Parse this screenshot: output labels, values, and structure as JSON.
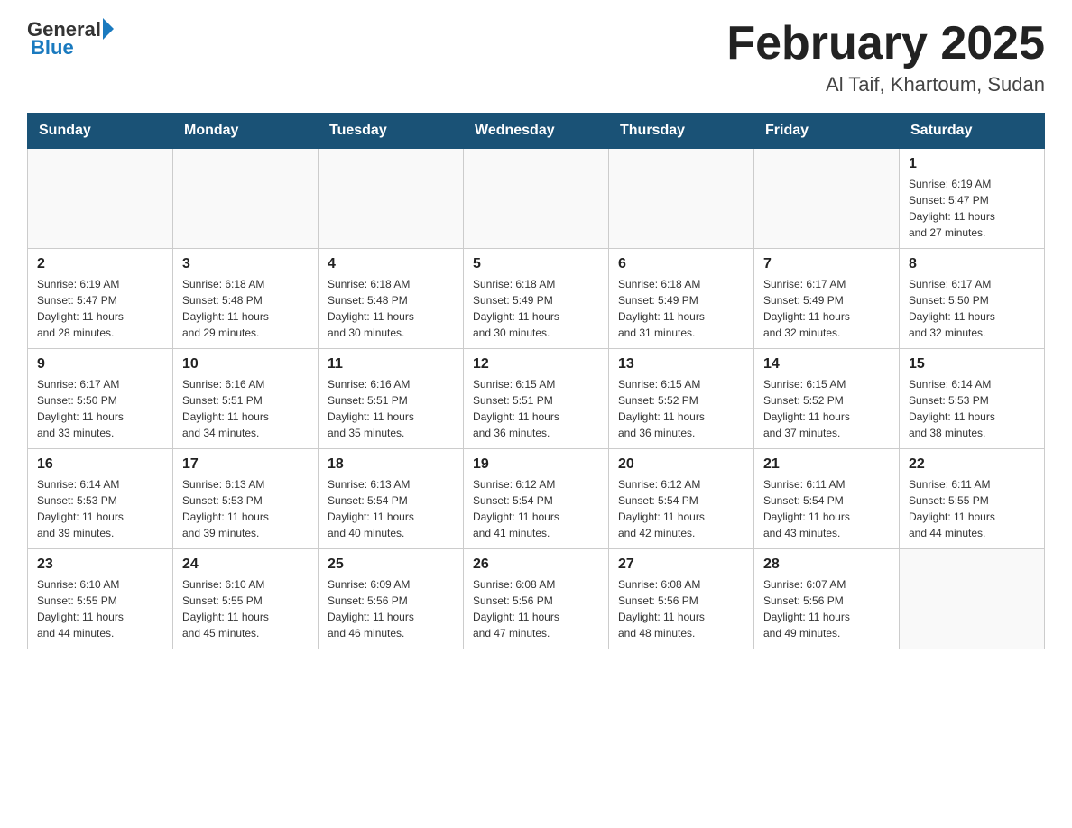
{
  "header": {
    "logo_general": "General",
    "logo_blue": "Blue",
    "title": "February 2025",
    "subtitle": "Al Taif, Khartoum, Sudan"
  },
  "days_of_week": [
    "Sunday",
    "Monday",
    "Tuesday",
    "Wednesday",
    "Thursday",
    "Friday",
    "Saturday"
  ],
  "weeks": [
    [
      {
        "day": "",
        "info": ""
      },
      {
        "day": "",
        "info": ""
      },
      {
        "day": "",
        "info": ""
      },
      {
        "day": "",
        "info": ""
      },
      {
        "day": "",
        "info": ""
      },
      {
        "day": "",
        "info": ""
      },
      {
        "day": "1",
        "info": "Sunrise: 6:19 AM\nSunset: 5:47 PM\nDaylight: 11 hours\nand 27 minutes."
      }
    ],
    [
      {
        "day": "2",
        "info": "Sunrise: 6:19 AM\nSunset: 5:47 PM\nDaylight: 11 hours\nand 28 minutes."
      },
      {
        "day": "3",
        "info": "Sunrise: 6:18 AM\nSunset: 5:48 PM\nDaylight: 11 hours\nand 29 minutes."
      },
      {
        "day": "4",
        "info": "Sunrise: 6:18 AM\nSunset: 5:48 PM\nDaylight: 11 hours\nand 30 minutes."
      },
      {
        "day": "5",
        "info": "Sunrise: 6:18 AM\nSunset: 5:49 PM\nDaylight: 11 hours\nand 30 minutes."
      },
      {
        "day": "6",
        "info": "Sunrise: 6:18 AM\nSunset: 5:49 PM\nDaylight: 11 hours\nand 31 minutes."
      },
      {
        "day": "7",
        "info": "Sunrise: 6:17 AM\nSunset: 5:49 PM\nDaylight: 11 hours\nand 32 minutes."
      },
      {
        "day": "8",
        "info": "Sunrise: 6:17 AM\nSunset: 5:50 PM\nDaylight: 11 hours\nand 32 minutes."
      }
    ],
    [
      {
        "day": "9",
        "info": "Sunrise: 6:17 AM\nSunset: 5:50 PM\nDaylight: 11 hours\nand 33 minutes."
      },
      {
        "day": "10",
        "info": "Sunrise: 6:16 AM\nSunset: 5:51 PM\nDaylight: 11 hours\nand 34 minutes."
      },
      {
        "day": "11",
        "info": "Sunrise: 6:16 AM\nSunset: 5:51 PM\nDaylight: 11 hours\nand 35 minutes."
      },
      {
        "day": "12",
        "info": "Sunrise: 6:15 AM\nSunset: 5:51 PM\nDaylight: 11 hours\nand 36 minutes."
      },
      {
        "day": "13",
        "info": "Sunrise: 6:15 AM\nSunset: 5:52 PM\nDaylight: 11 hours\nand 36 minutes."
      },
      {
        "day": "14",
        "info": "Sunrise: 6:15 AM\nSunset: 5:52 PM\nDaylight: 11 hours\nand 37 minutes."
      },
      {
        "day": "15",
        "info": "Sunrise: 6:14 AM\nSunset: 5:53 PM\nDaylight: 11 hours\nand 38 minutes."
      }
    ],
    [
      {
        "day": "16",
        "info": "Sunrise: 6:14 AM\nSunset: 5:53 PM\nDaylight: 11 hours\nand 39 minutes."
      },
      {
        "day": "17",
        "info": "Sunrise: 6:13 AM\nSunset: 5:53 PM\nDaylight: 11 hours\nand 39 minutes."
      },
      {
        "day": "18",
        "info": "Sunrise: 6:13 AM\nSunset: 5:54 PM\nDaylight: 11 hours\nand 40 minutes."
      },
      {
        "day": "19",
        "info": "Sunrise: 6:12 AM\nSunset: 5:54 PM\nDaylight: 11 hours\nand 41 minutes."
      },
      {
        "day": "20",
        "info": "Sunrise: 6:12 AM\nSunset: 5:54 PM\nDaylight: 11 hours\nand 42 minutes."
      },
      {
        "day": "21",
        "info": "Sunrise: 6:11 AM\nSunset: 5:54 PM\nDaylight: 11 hours\nand 43 minutes."
      },
      {
        "day": "22",
        "info": "Sunrise: 6:11 AM\nSunset: 5:55 PM\nDaylight: 11 hours\nand 44 minutes."
      }
    ],
    [
      {
        "day": "23",
        "info": "Sunrise: 6:10 AM\nSunset: 5:55 PM\nDaylight: 11 hours\nand 44 minutes."
      },
      {
        "day": "24",
        "info": "Sunrise: 6:10 AM\nSunset: 5:55 PM\nDaylight: 11 hours\nand 45 minutes."
      },
      {
        "day": "25",
        "info": "Sunrise: 6:09 AM\nSunset: 5:56 PM\nDaylight: 11 hours\nand 46 minutes."
      },
      {
        "day": "26",
        "info": "Sunrise: 6:08 AM\nSunset: 5:56 PM\nDaylight: 11 hours\nand 47 minutes."
      },
      {
        "day": "27",
        "info": "Sunrise: 6:08 AM\nSunset: 5:56 PM\nDaylight: 11 hours\nand 48 minutes."
      },
      {
        "day": "28",
        "info": "Sunrise: 6:07 AM\nSunset: 5:56 PM\nDaylight: 11 hours\nand 49 minutes."
      },
      {
        "day": "",
        "info": ""
      }
    ]
  ]
}
